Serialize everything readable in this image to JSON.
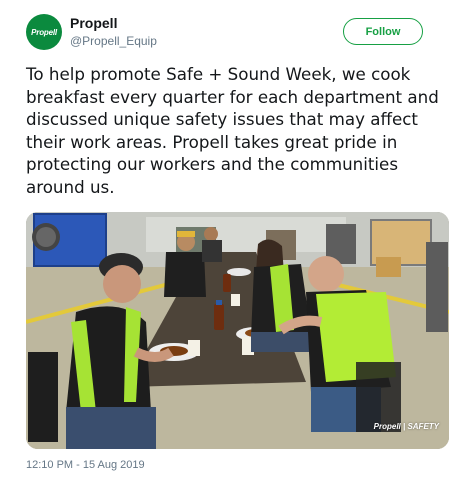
{
  "author": {
    "display_name": "Propell",
    "handle": "@Propell_Equip",
    "avatar_text": "Propell",
    "brand_color": "#0b8a3e"
  },
  "follow_button": {
    "label": "Follow",
    "color": "#17a044"
  },
  "tweet": {
    "text": "To help promote Safe + Sound Week, we cook breakfast every quarter for each department and discussed unique safety issues that may affect their work areas. Propell takes great pride in protecting our workers and the communities around us.",
    "timestamp": "12:10 PM - 15 Aug 2019"
  },
  "media": {
    "watermark": "Propell | SAFETY"
  }
}
